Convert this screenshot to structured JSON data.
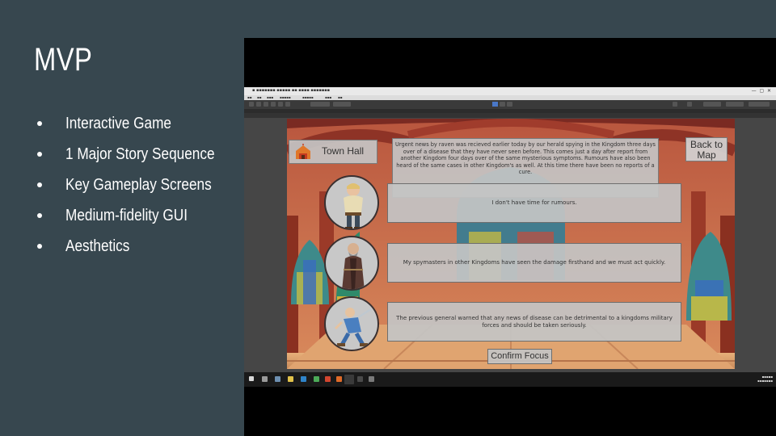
{
  "slide": {
    "title": "MVP",
    "bullets": [
      "Interactive Game",
      "1 Major Story Sequence",
      "Key Gameplay Screens",
      "Medium-fidelity GUI",
      "Aesthetics"
    ]
  },
  "game": {
    "location": "Town Hall",
    "back_label": "Back to Map",
    "narrative": "Urgent news by raven was recieved earlier today by our herald spying in the Kingdom three days over of a disease that they have never seen before. This comes just a day after report from another Kingdom four days over of the same mysterious symptoms. Rumours have also been heard of the same cases in other Kingdom's as well. At this time there have been no reports of a cure.",
    "options": [
      "I don't have time for rumours.",
      "My spymasters in other Kingdoms have seen the damage firsthand and we must act quickly.",
      "The previous general warned that any news of disease can be detrimental to a kingdoms military forces and should be taken seriously."
    ],
    "confirm_label": "Confirm Focus"
  },
  "colors": {
    "slide_bg": "#37474f",
    "video_bg": "#000000",
    "editor_bg": "#464646",
    "taskbar_bg": "#1a1a1a"
  },
  "icons": [
    "town-hall-icon",
    "play-icon",
    "pause-icon",
    "step-icon",
    "windows-start-icon"
  ]
}
